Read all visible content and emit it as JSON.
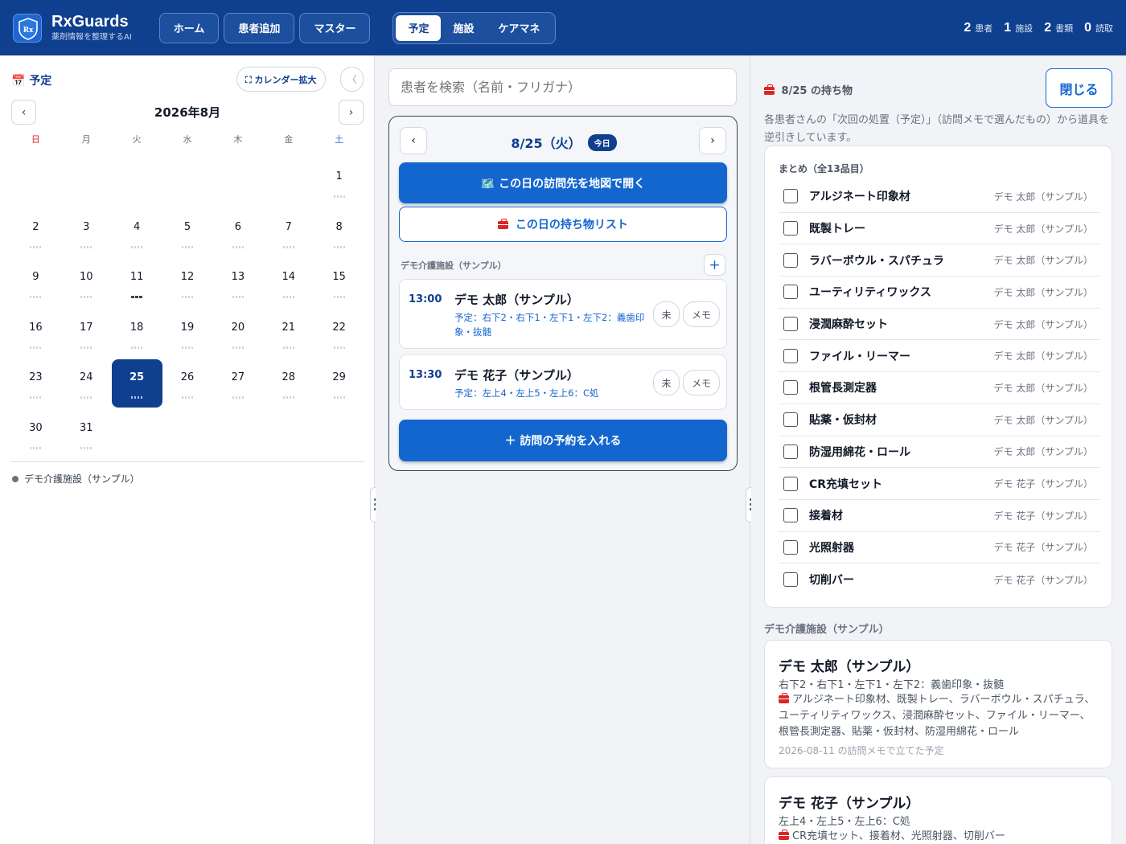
{
  "header": {
    "brand_name": "RxGuards",
    "brand_sub": "薬剤情報を整理するAI",
    "nav": [
      "ホーム",
      "患者追加",
      "マスター"
    ],
    "tabs": [
      "予定",
      "施設",
      "ケアマネ"
    ],
    "active_tab": "予定",
    "stats": [
      {
        "value": "2",
        "label": "患者"
      },
      {
        "value": "1",
        "label": "施設"
      },
      {
        "value": "2",
        "label": "書類"
      },
      {
        "value": "0",
        "label": "読取"
      }
    ]
  },
  "calendar": {
    "title": "予定",
    "expand_label": "カレンダー拡大",
    "collapse_label": "〈",
    "prev": "‹",
    "next": "›",
    "month": "2026年8月",
    "weekdays": [
      "日",
      "月",
      "火",
      "水",
      "木",
      "金",
      "土"
    ],
    "weeks": [
      [
        "",
        "",
        "",
        "",
        "",
        "",
        "1"
      ],
      [
        "2",
        "3",
        "4",
        "5",
        "6",
        "7",
        "8"
      ],
      [
        "9",
        "10",
        "11",
        "12",
        "13",
        "14",
        "15"
      ],
      [
        "16",
        "17",
        "18",
        "19",
        "20",
        "21",
        "22"
      ],
      [
        "23",
        "24",
        "25",
        "26",
        "27",
        "28",
        "29"
      ],
      [
        "30",
        "31",
        "",
        "",
        "",
        "",
        ""
      ]
    ],
    "selected_day": "25",
    "marked_day": "11",
    "legend": "デモ介護施設（サンプル）"
  },
  "day": {
    "search_placeholder": "患者を検索（名前・フリガナ）",
    "prev": "‹",
    "next": "›",
    "date": "8/25（火）",
    "today_badge": "今日",
    "map_button": "この日の訪問先を地図で開く",
    "list_button": "この日の持ち物リスト",
    "facility": "デモ介護施設（サンプル）",
    "add_icon": "+",
    "visits": [
      {
        "time": "13:00",
        "name": "デモ 太郎（サンプル）",
        "plan": "予定：右下2・右下1・左下1・左下2：義歯印象・抜髄",
        "status": "未",
        "memo": "メモ"
      },
      {
        "time": "13:30",
        "name": "デモ 花子（サンプル）",
        "plan": "予定：左上4・左上5・左上6：C処",
        "status": "未",
        "memo": "メモ"
      }
    ],
    "add_visit_button": "＋ 訪問の予約を入れる"
  },
  "packing": {
    "title": "8/25 の持ち物",
    "close_label": "閉じる",
    "description": "各患者さんの「次回の処置（予定）」（訪問メモで選んだもの）から道具を逆引きしています。",
    "summary_title": "まとめ（全13品目）",
    "items": [
      {
        "name": "アルジネート印象材",
        "patient": "デモ 太郎（サンプル）"
      },
      {
        "name": "既製トレー",
        "patient": "デモ 太郎（サンプル）"
      },
      {
        "name": "ラバーボウル・スパチュラ",
        "patient": "デモ 太郎（サンプル）"
      },
      {
        "name": "ユーティリティワックス",
        "patient": "デモ 太郎（サンプル）"
      },
      {
        "name": "浸潤麻酔セット",
        "patient": "デモ 太郎（サンプル）"
      },
      {
        "name": "ファイル・リーマー",
        "patient": "デモ 太郎（サンプル）"
      },
      {
        "name": "根管長測定器",
        "patient": "デモ 太郎（サンプル）"
      },
      {
        "name": "貼薬・仮封材",
        "patient": "デモ 太郎（サンプル）"
      },
      {
        "name": "防湿用綿花・ロール",
        "patient": "デモ 太郎（サンプル）"
      },
      {
        "name": "CR充填セット",
        "patient": "デモ 花子（サンプル）"
      },
      {
        "name": "接着材",
        "patient": "デモ 花子（サンプル）"
      },
      {
        "name": "光照射器",
        "patient": "デモ 花子（サンプル）"
      },
      {
        "name": "切削バー",
        "patient": "デモ 花子（サンプル）"
      }
    ],
    "section_label": "デモ介護施設（サンプル）",
    "patients": [
      {
        "name": "デモ 太郎（サンプル）",
        "plan": "右下2・右下1・左下1・左下2：義歯印象・抜髄",
        "tools": "アルジネート印象材、既製トレー、ラバーボウル・スパチュラ、ユーティリティワックス、浸潤麻酔セット、ファイル・リーマー、根管長測定器、貼薬・仮封材、防湿用綿花・ロール",
        "note": "2026-08-11 の訪問メモで立てた予定"
      },
      {
        "name": "デモ 花子（サンプル）",
        "plan": "左上4・左上5・左上6：C処",
        "tools": "CR充填セット、接着材、光照射器、切削バー",
        "note": ""
      }
    ]
  },
  "icons": {
    "logo": "shield-rx-icon",
    "calendar": "calendar-icon",
    "expand": "expand-icon",
    "map": "map-icon",
    "toolbox": "toolbox-icon",
    "grip": "drag-handle-icon"
  },
  "colors": {
    "header": "#0f3f8f",
    "primary": "#1466cf",
    "sunday": "#dc2626",
    "saturday": "#1f6fd6"
  }
}
